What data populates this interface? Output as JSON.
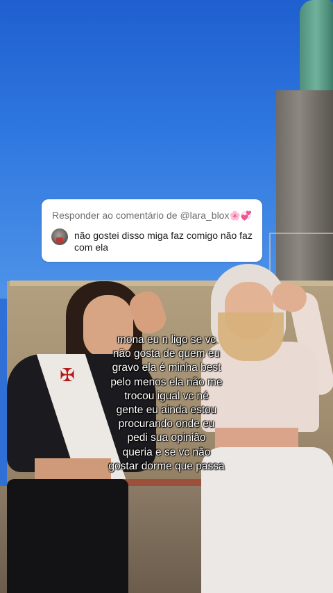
{
  "comment_reply": {
    "header": "Responder ao comentário de @lara_blox",
    "header_emoji": "🌸💞",
    "comment_text": "não gostei disso miga faz comigo não faz com ela"
  },
  "caption_lines": [
    "mona eu n ligo se vc",
    "não gosta de quem eu",
    "gravo ela é minha best",
    "pelo menos ela não me",
    "trocou igual vc né",
    "gente eu ainda estou",
    "procurando onde eu",
    "pedi sua opinião",
    "queria e se  vc não",
    "gostar dorme que passa"
  ],
  "colors": {
    "sky": "#2f78e0",
    "card_bg": "#ffffff",
    "caption_text": "#ffffff"
  }
}
